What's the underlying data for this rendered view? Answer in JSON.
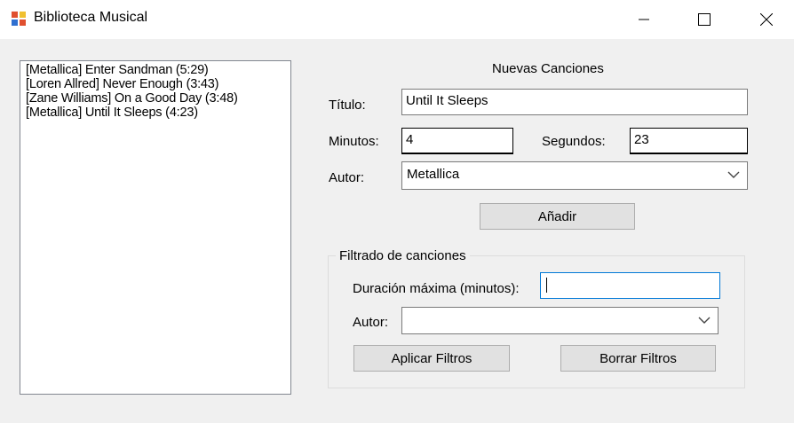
{
  "window": {
    "title": "Biblioteca Musical",
    "icon": "app-grid-icon",
    "controls": [
      "minimize-icon",
      "maximize-icon",
      "close-icon"
    ]
  },
  "song_list": {
    "items": [
      "[Metallica] Enter Sandman (5:29)",
      "[Loren Allred] Never Enough (3:43)",
      "[Zane Williams] On a Good Day (3:48)",
      "[Metallica] Until It Sleeps (4:23)"
    ]
  },
  "new_songs": {
    "header": "Nuevas Canciones",
    "title_label": "Título:",
    "title_value": "Until It Sleeps",
    "minutes_label": "Minutos:",
    "minutes_value": "4",
    "seconds_label": "Segundos:",
    "seconds_value": "23",
    "author_label": "Autor:",
    "author_value": "Metallica",
    "add_button": "Añadir"
  },
  "filters": {
    "group_title": "Filtrado de canciones",
    "max_duration_label": "Duración máxima (minutos):",
    "max_duration_value": "",
    "author_label": "Autor:",
    "author_value": "",
    "apply_button": "Aplicar Filtros",
    "clear_button": "Borrar Filtros"
  },
  "colors": {
    "titlebar": "#ffffff",
    "client": "#f0f0f0",
    "focus_border": "#0078d7",
    "button_face": "#e1e1e1"
  }
}
